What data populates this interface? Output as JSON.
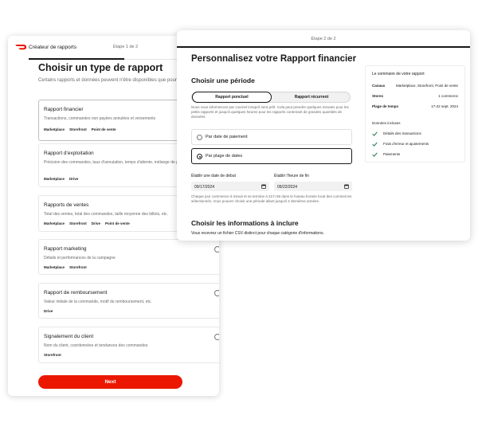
{
  "colors": {
    "accent": "#eb1700",
    "check": "#2e7d4f",
    "text": "#191919",
    "muted": "#6a6a6a"
  },
  "selector": {
    "app_title": "Créateur de rapports",
    "step": "Étape 1 de 2",
    "heading": "Choisir un type de rapport",
    "subtitle": "Certains rapports et données peuvent n'être disponibles que pour certains canaux.",
    "report_types": [
      {
        "title": "Rapport financier",
        "desc": "Transactions, commandes non payées annulées et versements",
        "tags": [
          "Marketplace",
          "Storefront",
          "Point de vente"
        ]
      },
      {
        "title": "Rapport d'exploitation",
        "desc": "Précision des commandes, taux d'annulation, temps d'attente, mélange de produits, etc.",
        "tags": [
          "Marketplace",
          "Drive"
        ]
      },
      {
        "title": "Rapports de ventes",
        "desc": "Total des ventes, total des commandes, taille moyenne des billets, etc.",
        "tags": [
          "Marketplace",
          "Storefront",
          "Drive",
          "Point de vente"
        ]
      },
      {
        "title": "Rapport marketing",
        "desc": "Détails et performances de la campagne",
        "tags": [
          "Marketplace",
          "Storefront"
        ]
      },
      {
        "title": "Rapport de remboursement",
        "desc": "Valeur initiale de la commande, motif du remboursement, etc.",
        "tags": [
          "Drive"
        ]
      },
      {
        "title": "Signalement du client",
        "desc": "Nom du client, coordonnées et tendances des commandes",
        "tags": [
          "Storefront"
        ]
      }
    ],
    "next_label": "Next"
  },
  "customize": {
    "step": "Étape 2 de 2",
    "heading": "Personnalisez votre Rapport financier",
    "period_heading": "Choisir une période",
    "seg_one_time": "Rapport ponctuel",
    "seg_recurring": "Rapport récurrent",
    "period_note": "Nous vous informerons par courriel lorsqu'il sera prêt. Cela peut prendre quelques minutes pour les petits rapports et jusqu'à quelques heures pour les rapports contenant de grandes quantités de données.",
    "options": [
      "Par date de paiement",
      "Par plage de dates"
    ],
    "selected_option": "Par plage de dates",
    "start_label": "Établir une date de début",
    "start_value": "09/17/2024",
    "end_label": "Établir l'heure de fin",
    "end_value": "09/22/2024",
    "date_note": "Chaque jour commence à minuit et se termine à 23 h 59 dans le fuseau horaire local des commerces sélectionnés. Vous pouvez choisir une période allant jusqu'à 2 dernières années.",
    "info_heading": "Choisir les informations à inclure",
    "info_sub": "Vous recevrez un fichier CSV distinct pour chaque catégorie d'informations."
  },
  "summary": {
    "title": "Le sommaire de votre rapport",
    "channels_label": "Canaux",
    "channels_value": "Marketplace, Storefront, Point de vente",
    "stores_label": "Stores",
    "stores_value": "1 commerce",
    "range_label": "Plage de temps",
    "range_value": "17-22 sept. 2024",
    "data_heading": "Données incluses",
    "data_items": [
      "Détails des transactions",
      "Frais d'erreur et ajustements",
      "Paiements"
    ]
  }
}
